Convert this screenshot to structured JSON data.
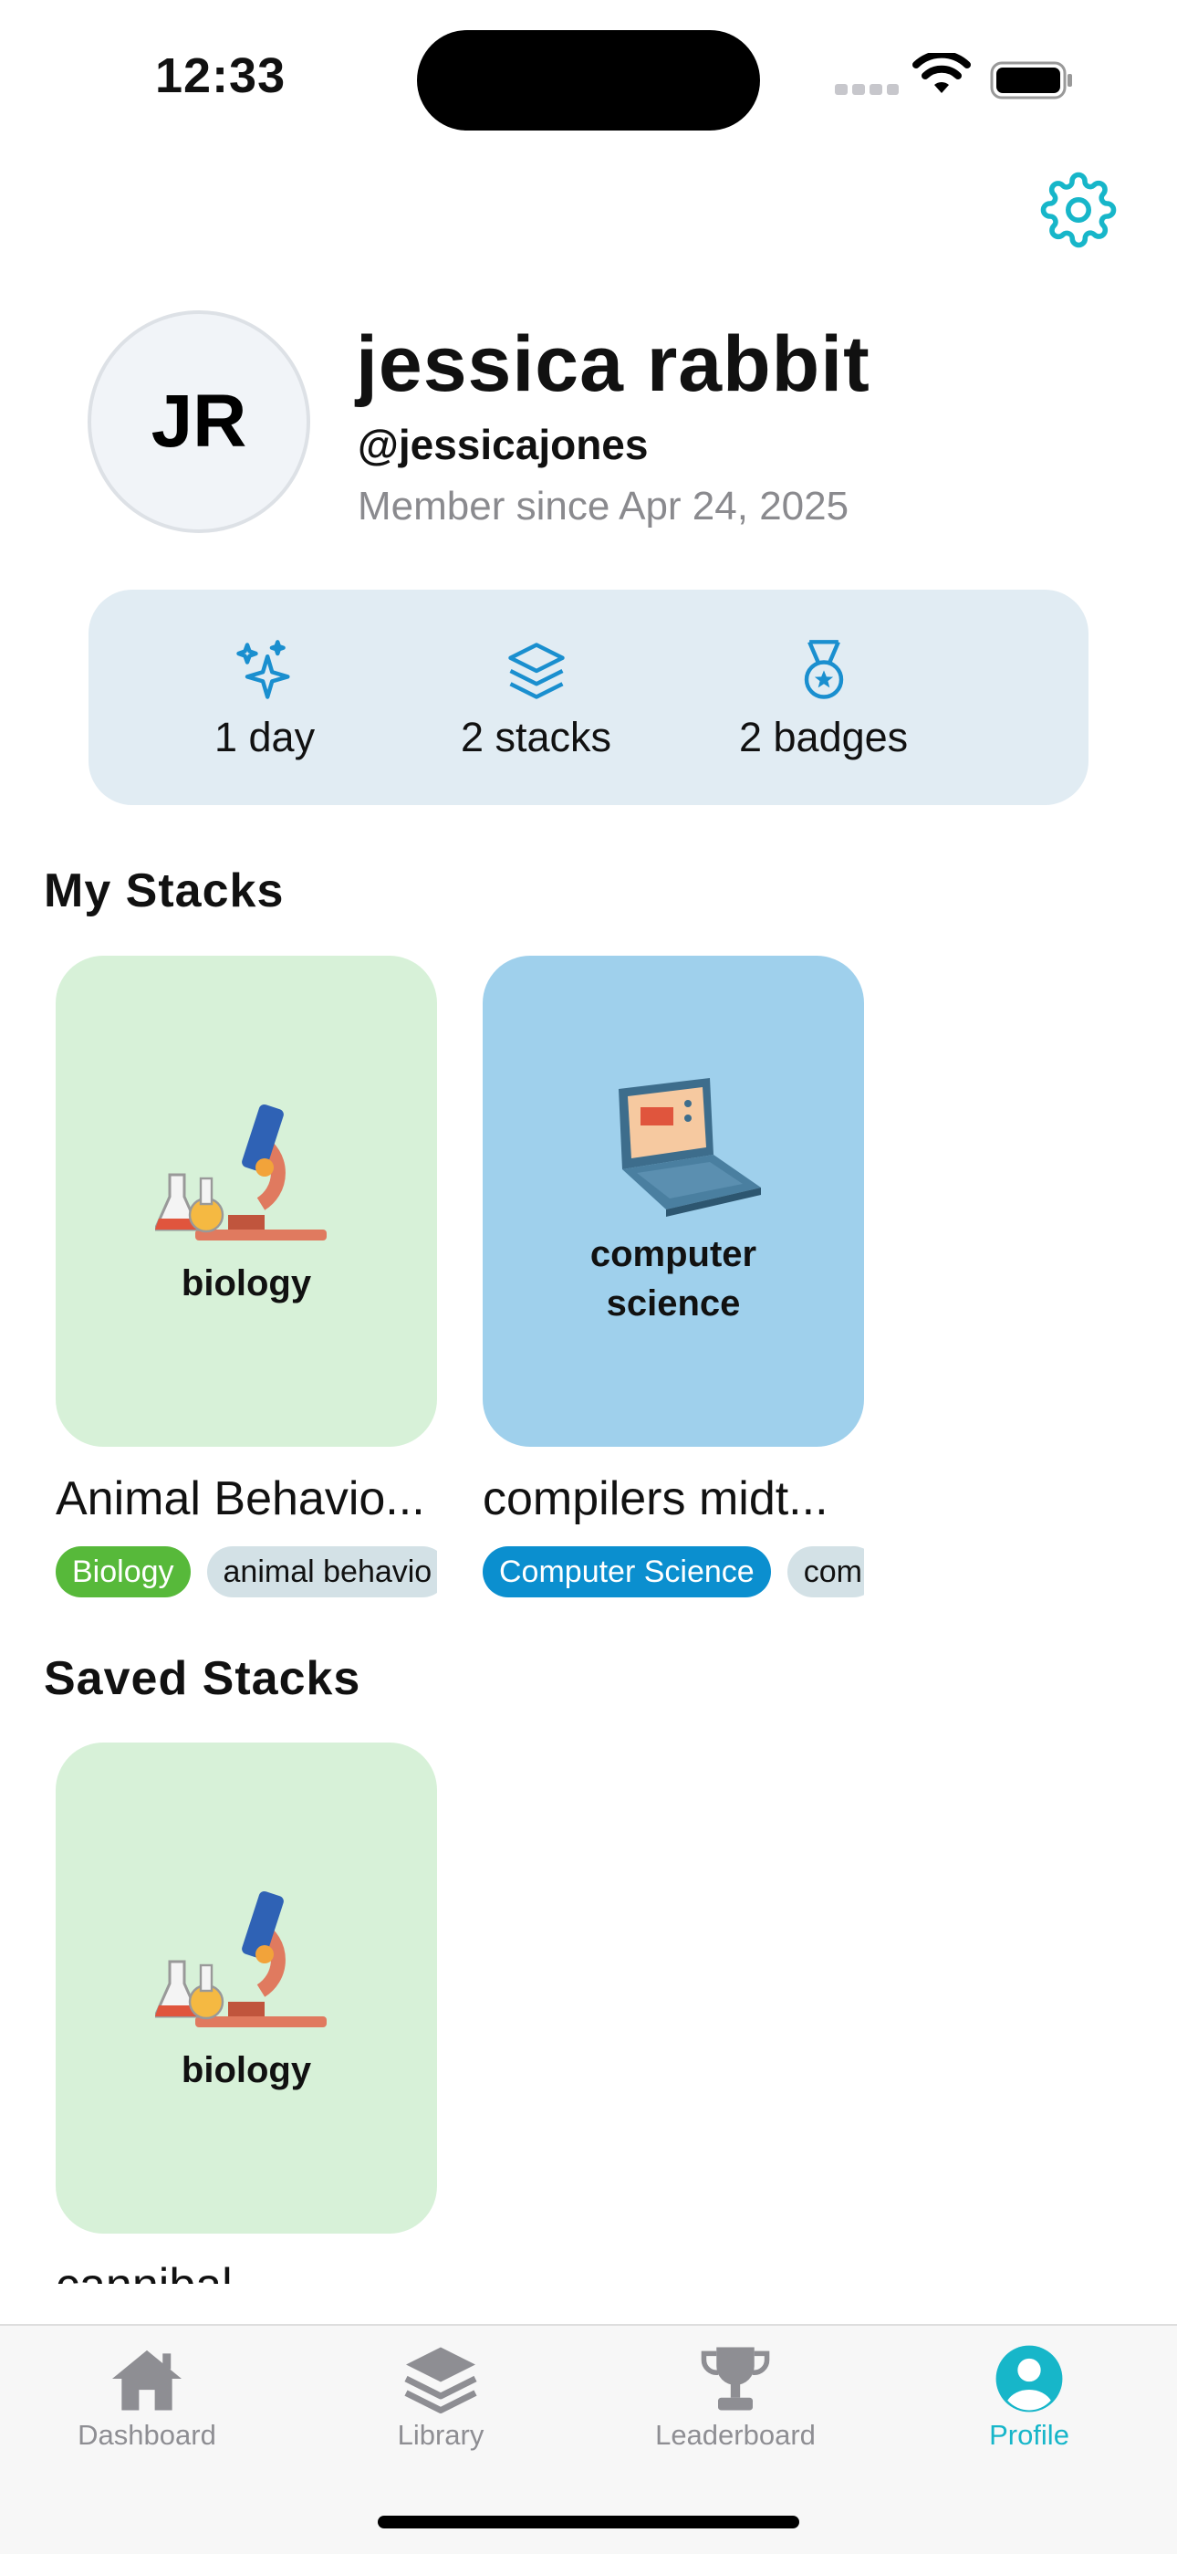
{
  "status_bar": {
    "time": "12:33"
  },
  "profile": {
    "initials": "JR",
    "name": "jessica rabbit",
    "handle": "@jessicajones",
    "member_since": "Member since Apr 24, 2025"
  },
  "stats": [
    {
      "icon": "sparkles-icon",
      "label": "1 day"
    },
    {
      "icon": "stack-icon",
      "label": "2 stacks"
    },
    {
      "icon": "medal-icon",
      "label": "2 badges"
    }
  ],
  "my_stacks": {
    "title": "My Stacks",
    "items": [
      {
        "cover_label": "biology",
        "title": "Animal Behavio...",
        "tags": [
          "Biology",
          "animal behavio"
        ]
      },
      {
        "cover_label": "computer science",
        "title": "compilers midt...",
        "tags": [
          "Computer Science",
          "com"
        ]
      }
    ]
  },
  "saved_stacks": {
    "title": "Saved Stacks",
    "items": [
      {
        "cover_label": "biology",
        "title": "cannibal"
      }
    ]
  },
  "tabbar": {
    "tabs": [
      {
        "label": "Dashboard",
        "icon": "house-icon"
      },
      {
        "label": "Library",
        "icon": "layers-icon"
      },
      {
        "label": "Leaderboard",
        "icon": "trophy-icon"
      },
      {
        "label": "Profile",
        "icon": "person-icon",
        "active": true
      }
    ]
  },
  "colors": {
    "accent": "#17b6c9",
    "stat_icon": "#1a8fcf",
    "green_card": "#d7f1d8",
    "blue_card": "#9fd0ec"
  }
}
